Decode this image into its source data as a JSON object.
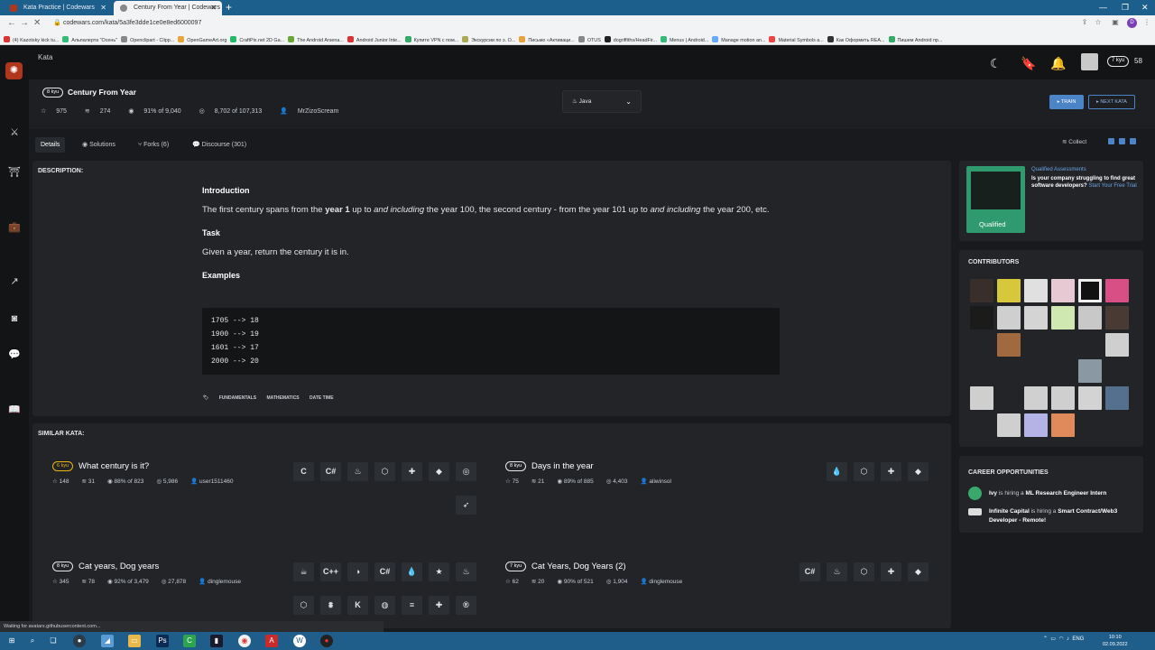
{
  "browser": {
    "tabs": [
      {
        "label": "Kata Practice | Codewars"
      },
      {
        "label": "Century From Year | Codewars"
      }
    ],
    "url": "codewars.com/kata/5a3fe3dde1ce0e8ed6000097",
    "profile_initial": "D",
    "bookmarks": [
      "(4) Kazotsky kick tu...",
      "Альпалерта \"Осень\"",
      "Openclipart - Clipp...",
      "OpenGameArt.org",
      "CraftPix.net 2D Ga...",
      "The Android Arsena...",
      "Android Junior Inte...",
      "Купите VPN с пом...",
      "Экскурсии по э. О...",
      "Письмо «Активаци...",
      "OTUS",
      "dogriffiths/HeadFir...",
      "Menus | Android...",
      "Manage motion an...",
      "Material Symbols a...",
      "Как Оформить REA...",
      "Пишем Android пр..."
    ]
  },
  "header": {
    "crumb": "Kata",
    "rank": "7 kyu",
    "honor": "58"
  },
  "kata": {
    "rank": "8 kyu",
    "title": "Century From Year",
    "stats": {
      "stars": "975",
      "collections": "274",
      "satisfaction": "91% of 9,040",
      "completed": "8,702 of 107,313",
      "author": "MrZizoScream"
    },
    "language": "Java",
    "train_label": "TRAIN",
    "next_label": "NEXT KATA"
  },
  "tabs": [
    {
      "label": "Details"
    },
    {
      "label": "Solutions"
    },
    {
      "label": "Forks (6)"
    },
    {
      "label": "Discourse (301)"
    }
  ],
  "collect_label": "Collect",
  "description": {
    "heading": "DESCRIPTION:",
    "intro_heading": "Introduction",
    "intro_1": "The first century spans from the ",
    "intro_2": "year 1",
    "intro_3": " up to ",
    "intro_4": "and including",
    "intro_5": " the year 100, the second century - from the year 101 up to ",
    "intro_6": "and including",
    "intro_7": " the year 200, etc.",
    "task_heading": "Task",
    "task_text": "Given a year, return the century it is in.",
    "examples_heading": "Examples",
    "code_lines": [
      "1705 --> 18",
      "1900 --> 19",
      "1601 --> 17",
      "2000 --> 20"
    ],
    "tags": [
      "FUNDAMENTALS",
      "MATHEMATICS",
      "DATE TIME"
    ]
  },
  "similar": {
    "heading": "SIMILAR KATA:",
    "items": [
      {
        "rank": "6 kyu",
        "title": "What century is it?",
        "stars": "148",
        "collections": "31",
        "satisfaction": "88% of 823",
        "completed": "5,986",
        "author": "user1511460"
      },
      {
        "rank": "8 kyu",
        "title": "Days in the year",
        "stars": "75",
        "collections": "21",
        "satisfaction": "89% of 885",
        "completed": "4,403",
        "author": "aliwinsol"
      },
      {
        "rank": "8 kyu",
        "title": "Cat years, Dog years",
        "stars": "345",
        "collections": "78",
        "satisfaction": "92% of 3,479",
        "completed": "27,878",
        "author": "dinglemouse"
      },
      {
        "rank": "7 kyu",
        "title": "Cat Years, Dog Years (2)",
        "stars": "62",
        "collections": "20",
        "satisfaction": "90% of 521",
        "completed": "1,904",
        "author": "dinglemouse"
      }
    ]
  },
  "ad": {
    "title": "Qualified Assessments",
    "text": "Is your company struggling to find great software developers?",
    "link": "Start Your Free Trial",
    "thumb_label": "Qualified"
  },
  "contributors": {
    "heading": "CONTRIBUTORS"
  },
  "careers": {
    "heading": "CAREER OPPORTUNITIES",
    "jobs": [
      {
        "company": "Ivy",
        "connector": " is hiring a ",
        "role": "ML Research Engineer Intern"
      },
      {
        "company": "Infinite Capital",
        "connector": " is hiring a ",
        "role": "Smart Contract/Web3 Developer - Remote!"
      }
    ]
  },
  "status_text": "Waiting for avatars.githubusercontent.com...",
  "taskbar": {
    "lang": "ENG",
    "time": "10:10",
    "date": "02.09.2022"
  },
  "colors": {
    "accent": "#4c84c8",
    "brand": "#b1361e",
    "kyu_yellow": "#ecb613"
  }
}
